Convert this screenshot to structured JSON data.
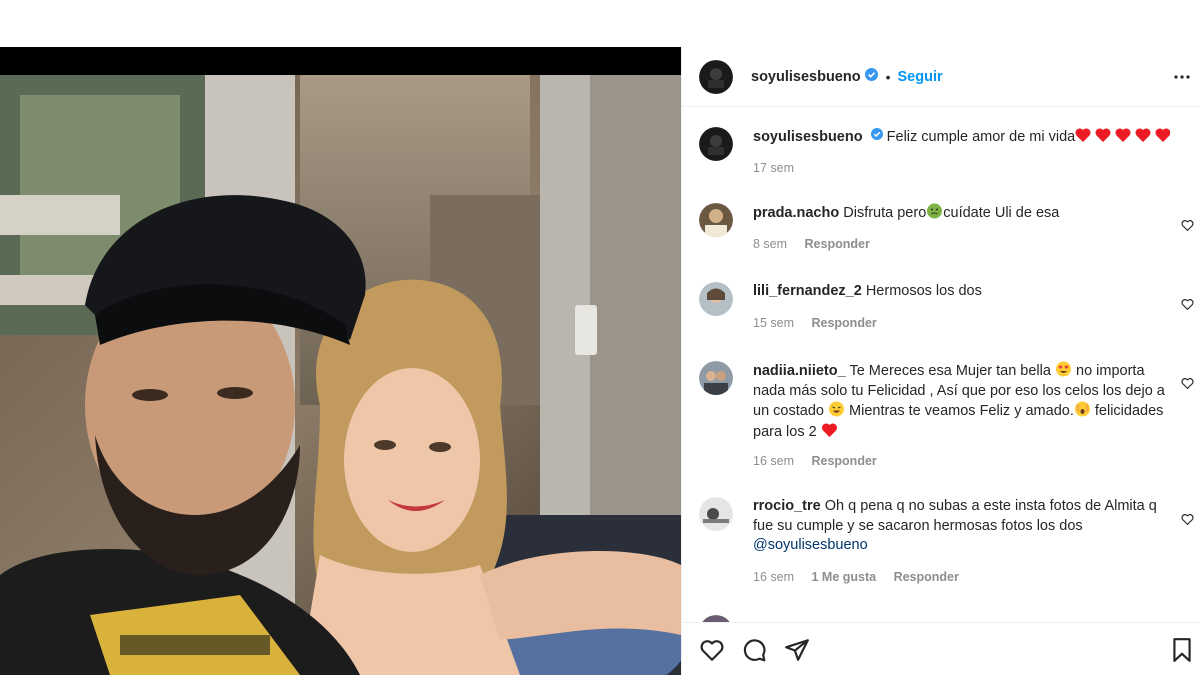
{
  "post": {
    "author": "soyulisesbueno",
    "follow_label": "Seguir",
    "separator": "•",
    "caption_text": "Feliz cumple amor de mi vida",
    "caption_time": "17 sem"
  },
  "comments": [
    {
      "user": "prada.nacho",
      "text_before": "Disfruta pero",
      "text_after": "cuídate Uli de esa",
      "time": "8 sem",
      "reply": "Responder"
    },
    {
      "user": "lili_fernandez_2",
      "text": "Hermosos los dos",
      "time": "15 sem",
      "reply": "Responder"
    },
    {
      "user": "nadiia.niieto_",
      "text_a": "Te Mereces esa Mujer tan bella",
      "text_b": "no importa nada más solo tu Felicidad , Así que por eso los celos los dejo a un costado",
      "text_c": "Mientras te veamos Feliz y amado.",
      "text_d": "felicidades para los 2",
      "time": "16 sem",
      "reply": "Responder"
    },
    {
      "user": "rrocio_tre",
      "text": "Oh q pena q no subas a este insta fotos de Almita q fue su cumple y se sacaron hermosas fotos los dos",
      "mention": "@soyulisesbueno",
      "time": "16 sem",
      "likes": "1 Me gusta",
      "reply": "Responder"
    }
  ],
  "icons": {
    "more": "more-options-icon",
    "verified": "verified-badge-icon",
    "like": "heart-icon",
    "comment": "comment-icon",
    "share": "share-icon",
    "save": "bookmark-icon"
  },
  "colors": {
    "accent": "#0095f6",
    "verified": "#3897f0",
    "heart": "#ed1c24",
    "muted": "#8e8e8e"
  }
}
